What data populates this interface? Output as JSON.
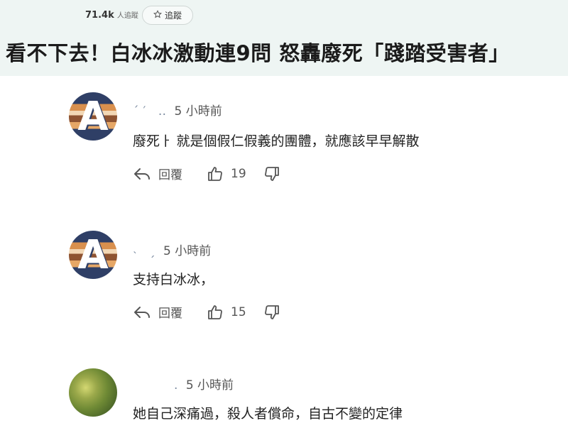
{
  "header": {
    "followers_count": "71.4k",
    "followers_unit": "人追蹤",
    "follow_label": "追蹤",
    "headline": "看不下去！白冰冰激動連9問 怒轟廢死「踐踏受害者」"
  },
  "comments": [
    {
      "name": "ˊ′  ‥",
      "time": "5 小時前",
      "text": "廢死ㅏ   就是個假仁假義的團體，就應該早早解散",
      "reply_label": "回覆",
      "likes": "19",
      "avatar_letter": "A"
    },
    {
      "name": "˴ ˏ",
      "time": "5 小時前",
      "text": "支持白冰冰，",
      "reply_label": "回覆",
      "likes": "15",
      "avatar_letter": "A"
    },
    {
      "name": ".",
      "time": "5 小時前",
      "text": "她自己深痛過，殺人者償命，自古不變的定律"
    }
  ],
  "colors": {
    "header_bg": "#eef5f3",
    "avatar_navy": "#2f3f66",
    "avatar_orange": "#d9904e",
    "avatar_leaf": "#6f8a35"
  },
  "icons": [
    "star-icon",
    "reply-arrow-icon",
    "thumbs-up-icon",
    "thumbs-down-icon"
  ]
}
